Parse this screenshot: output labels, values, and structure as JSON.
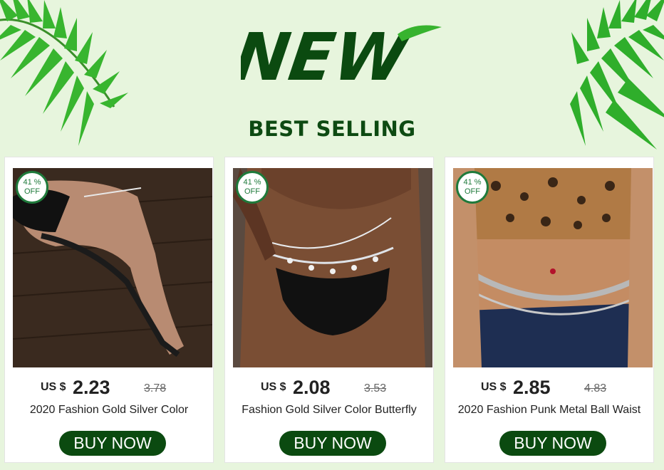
{
  "header": {
    "logo_text": "NEW",
    "heading": "BEST SELLING"
  },
  "colors": {
    "background": "#e7f5dd",
    "accent": "#0b4a10",
    "badge": "#1f7a3b"
  },
  "products": [
    {
      "discount_value": "41 %",
      "discount_label": "OFF",
      "currency": "US $",
      "price": "2.23",
      "old_price": "3.78",
      "title": "2020 Fashion Gold Silver Color",
      "button": "BUY NOW"
    },
    {
      "discount_value": "41 %",
      "discount_label": "OFF",
      "currency": "US $",
      "price": "2.08",
      "old_price": "3.53",
      "title": "Fashion Gold Silver Color Butterfly",
      "button": "BUY NOW"
    },
    {
      "discount_value": "41 %",
      "discount_label": "OFF",
      "currency": "US $",
      "price": "2.85",
      "old_price": "4.83",
      "title": "2020 Fashion Punk Metal Ball Waist",
      "button": "BUY NOW"
    }
  ]
}
